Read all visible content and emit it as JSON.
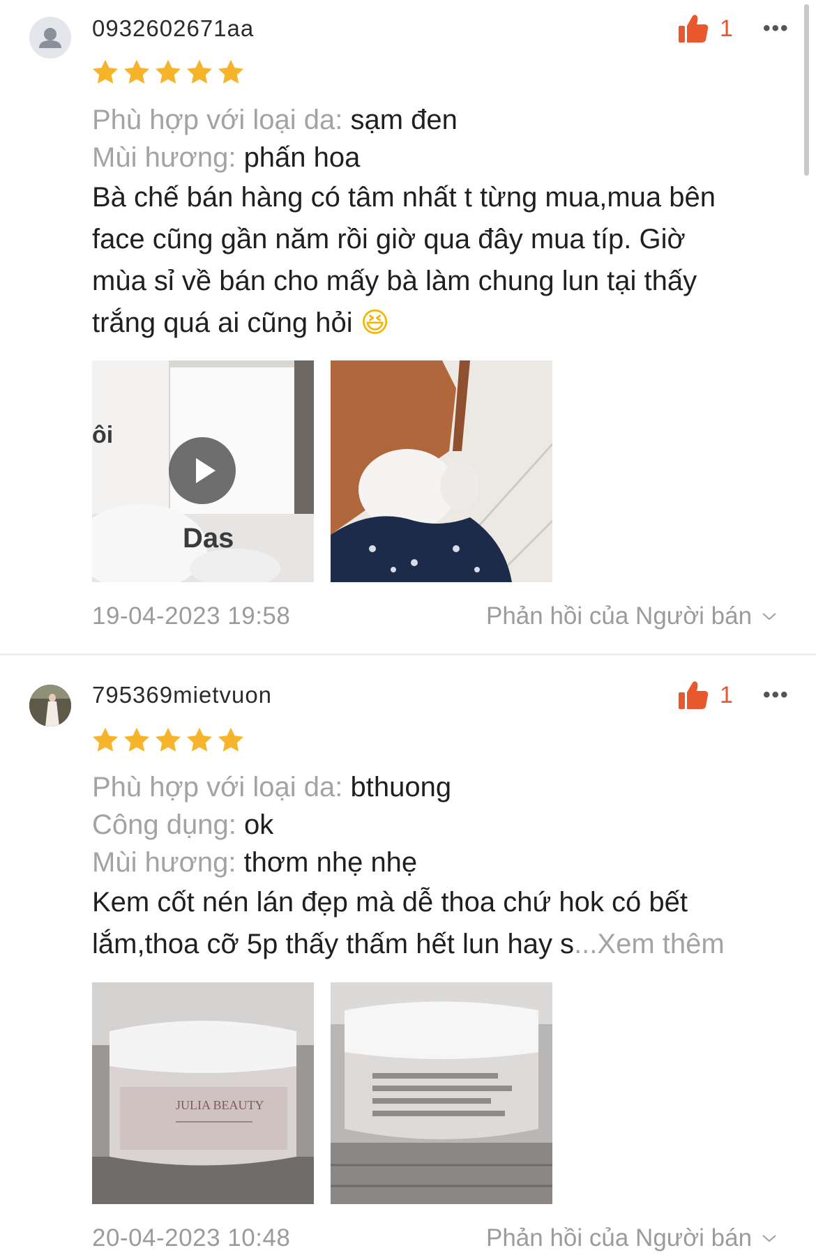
{
  "reviews": [
    {
      "username": "0932602671aa",
      "avatar": "default-user-icon",
      "rating": 5,
      "likes": "1",
      "attributes": [
        {
          "label": "Phù hợp với loại da:",
          "value": "sạm đen"
        },
        {
          "label": "Mùi hương:",
          "value": "phấn hoa"
        }
      ],
      "body_lines": [
        "Bà chế bán hàng có tâm nhất t từng mua,mua bên",
        "face cũng gần năm rồi giờ qua đây mua típ. Giờ",
        "mùa sỉ về bán cho mấy bà làm chung lun tại thấy",
        "trắng quá ai cũng hỏi"
      ],
      "emoji": "😆",
      "media": [
        {
          "kind": "video",
          "icon": "play-icon"
        },
        {
          "kind": "photo"
        }
      ],
      "date": "19-04-2023 19:58",
      "seller_reply": "Phản hồi của Người bán"
    },
    {
      "username": "795369mietvuon",
      "avatar": "user-photo",
      "rating": 5,
      "likes": "1",
      "attributes": [
        {
          "label": "Phù hợp với loại da:",
          "value": "bthuong"
        },
        {
          "label": "Công dụng:",
          "value": "ok"
        },
        {
          "label": "Mùi hương:",
          "value": "thơm nhẹ nhẹ"
        }
      ],
      "body_lines": [
        "Kem cốt nén lán đẹp mà dễ thoa chứ hok có bết",
        "lắm,thoa cỡ 5p thấy thấm hết lun hay s"
      ],
      "see_more": "...Xem thêm",
      "media": [
        {
          "kind": "photo"
        },
        {
          "kind": "photo"
        }
      ],
      "date": "20-04-2023 10:48",
      "seller_reply": "Phản hồi của Người bán"
    }
  ],
  "colors": {
    "accent": "#e8582f",
    "star": "#f6b42a",
    "muted_text": "#9b9b9b"
  },
  "icons": {
    "like": "thumbs-up-icon",
    "more": "more-options-icon",
    "star": "star-icon",
    "chevron": "chevron-down-icon"
  },
  "more_symbol": "•••"
}
